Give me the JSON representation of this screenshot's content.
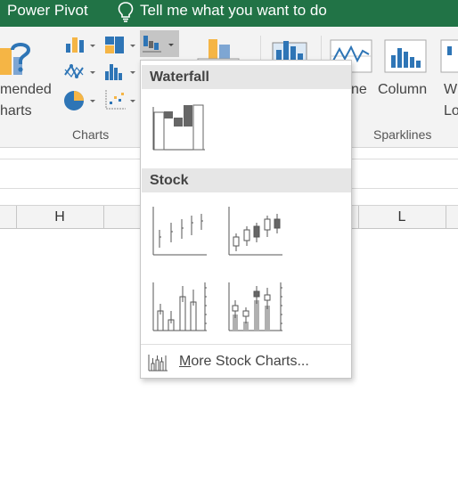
{
  "titlebar": {
    "power_pivot": "Power Pivot",
    "tell_me": "Tell me what you want to do",
    "bg_color": "#217346"
  },
  "ribbon": {
    "recommended_charts_line1": "mended",
    "recommended_charts_line2": "harts",
    "charts_group_label": "Charts",
    "sparkline_line_label": "ne",
    "sparkline_column_label": "Column",
    "sparkline_winloss_line1": "W",
    "sparkline_winloss_line2": "Lo",
    "sparklines_group_label": "Sparklines"
  },
  "columns": [
    "H",
    "L"
  ],
  "dropdown": {
    "waterfall_header": "Waterfall",
    "stock_header": "Stock",
    "more_first_letter": "M",
    "more_rest": "ore Stock Charts...",
    "charts": [
      {
        "name": "Waterfall"
      },
      {
        "name": "High-Low-Close"
      },
      {
        "name": "Open-High-Low-Close"
      },
      {
        "name": "Volume-High-Low-Close"
      },
      {
        "name": "Volume-Open-High-Low-Close"
      }
    ]
  },
  "colors": {
    "accent_blue": "#2e75b6",
    "accent_orange": "#f5b545",
    "selected_button": "#c5c5c5",
    "section_header_bg": "#e6e6e6"
  }
}
